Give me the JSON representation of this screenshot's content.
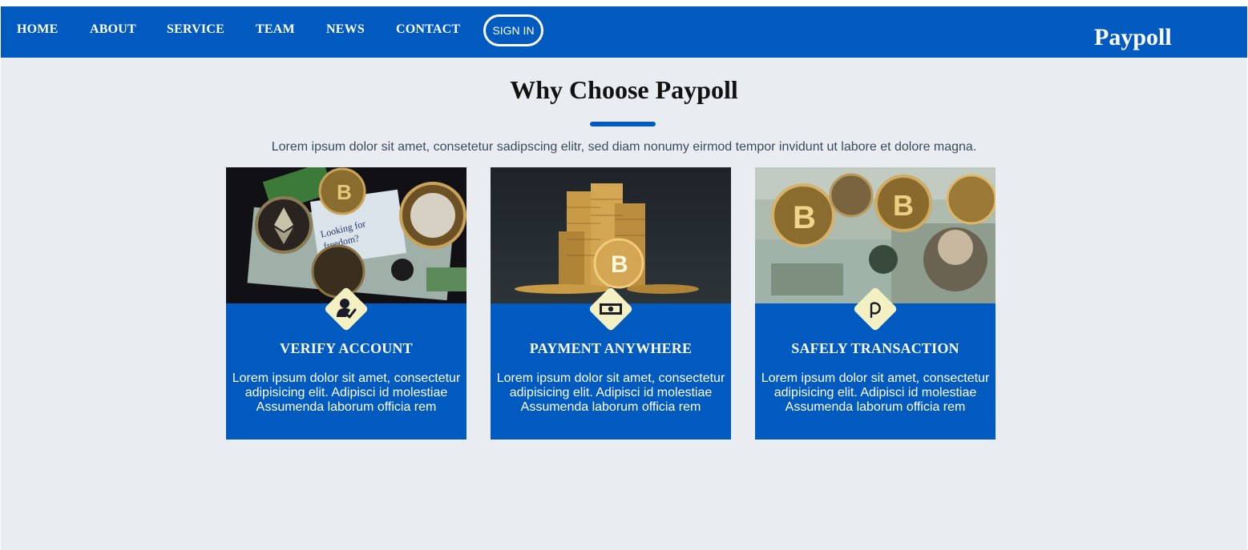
{
  "nav": {
    "links": [
      "HOME",
      "ABOUT",
      "SERVICE",
      "TEAM",
      "NEWS",
      "CONTACT"
    ],
    "signin_label": "SIGN IN",
    "brand": "Paypoll"
  },
  "section": {
    "title": "Why Choose Paypoll",
    "subtitle": "Lorem ipsum dolor sit amet, consetetur sadipscing elitr, sed diam nonumy eirmod tempor invidunt ut labore et dolore magna."
  },
  "cards": [
    {
      "title": "VERIFY ACCOUNT",
      "text": "Lorem ipsum dolor sit amet, consectetur adipisicing elit. Adipisci id molestiae Assumenda laborum officia rem",
      "icon": "verified-user-icon"
    },
    {
      "title": "PAYMENT ANYWHERE",
      "text": "Lorem ipsum dolor sit amet, consectetur adipisicing elit. Adipisci id molestiae Assumenda laborum officia rem",
      "icon": "banknote-icon"
    },
    {
      "title": "SAFELY TRANSACTION",
      "text": "Lorem ipsum dolor sit amet, consectetur adipisicing elit. Adipisci id molestiae Assumenda laborum officia rem",
      "icon": "paypoll-p-icon"
    }
  ],
  "colors": {
    "primary": "#005ac0",
    "background": "#e9edf1",
    "badge": "#f3f1c3",
    "heading": "#111111",
    "white": "#ffffff"
  }
}
